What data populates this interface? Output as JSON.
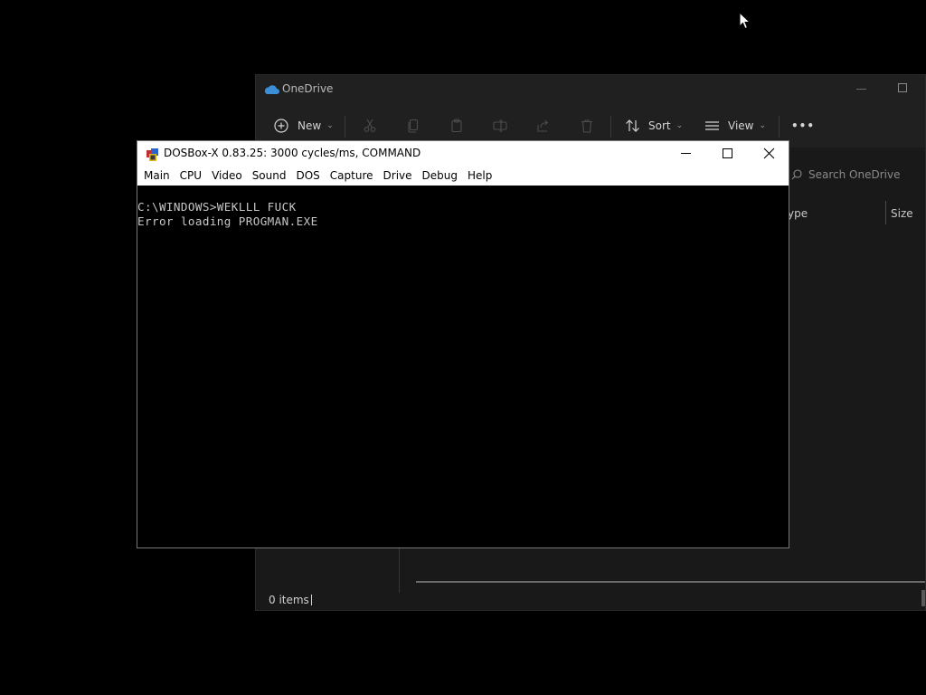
{
  "explorer": {
    "title": "OneDrive",
    "toolbar": {
      "new_label": "New",
      "sort_label": "Sort",
      "view_label": "View",
      "more_label": "•••"
    },
    "search_placeholder": "Search OneDrive",
    "columns": [
      "ype",
      "Size"
    ],
    "status_text": "0 items"
  },
  "dosbox": {
    "title": "DOSBox-X 0.83.25: 3000 cycles/ms, COMMAND",
    "menu": [
      "Main",
      "CPU",
      "Video",
      "Sound",
      "DOS",
      "Capture",
      "Drive",
      "Debug",
      "Help"
    ],
    "console_lines": [
      "C:\\WINDOWS>WEKLLL FUCK",
      "Error loading PROGMAN.EXE"
    ]
  },
  "icons": {
    "onedrive": "cloud-icon",
    "new": "plus-circle-icon",
    "cut": "scissors-icon",
    "copy": "copy-icon",
    "paste": "paste-icon",
    "rename": "rename-icon",
    "share": "share-icon",
    "delete": "trash-icon",
    "sort": "sort-arrows-icon",
    "view": "list-view-icon",
    "search": "search-icon",
    "dosbox": "dosbox-app-icon",
    "minimize": "minimize-icon",
    "maximize": "maximize-icon",
    "close": "close-icon",
    "pointer": "mouse-pointer-icon"
  },
  "colors": {
    "desktop": "#000000",
    "explorer_bg": "#191919",
    "explorer_chrome": "#202020",
    "onedrive_blue": "#3a8fd8",
    "dos_text": "#c7c7c7"
  }
}
